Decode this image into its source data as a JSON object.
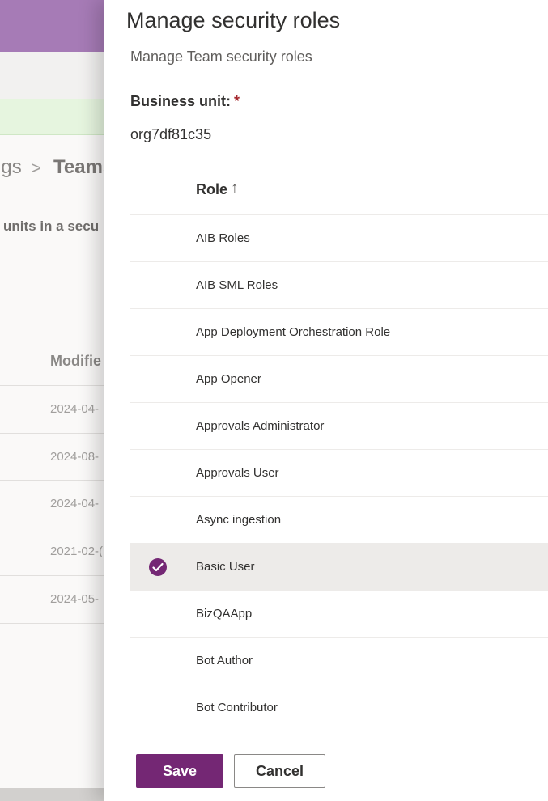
{
  "background": {
    "breadcrumb_parent": "ngs",
    "breadcrumb_separator": ">",
    "breadcrumb_current": "Teams",
    "description": "units in a secu",
    "column_header": "Modifie",
    "rows": [
      "2024-04-",
      "2024-08-",
      "2024-04-",
      "2021-02-(",
      "2024-05-"
    ]
  },
  "panel": {
    "title": "Manage security roles",
    "subtitle": "Manage Team security roles",
    "business_unit_label": "Business unit:",
    "required_marker": "*",
    "business_unit_value": "org7df81c35",
    "grid": {
      "column_header": "Role",
      "sort_icon": "↑",
      "rows": [
        {
          "name": "AIB Roles",
          "selected": false
        },
        {
          "name": "AIB SML Roles",
          "selected": false
        },
        {
          "name": "App Deployment Orchestration Role",
          "selected": false
        },
        {
          "name": "App Opener",
          "selected": false
        },
        {
          "name": "Approvals Administrator",
          "selected": false
        },
        {
          "name": "Approvals User",
          "selected": false
        },
        {
          "name": "Async ingestion",
          "selected": false
        },
        {
          "name": "Basic User",
          "selected": true
        },
        {
          "name": "BizQAApp",
          "selected": false
        },
        {
          "name": "Bot Author",
          "selected": false
        },
        {
          "name": "Bot Contributor",
          "selected": false
        }
      ]
    },
    "save_label": "Save",
    "cancel_label": "Cancel"
  },
  "colors": {
    "accent": "#742774",
    "selected_row": "#edebe9",
    "required": "#a4262c",
    "header_bar": "#a67bb6"
  }
}
